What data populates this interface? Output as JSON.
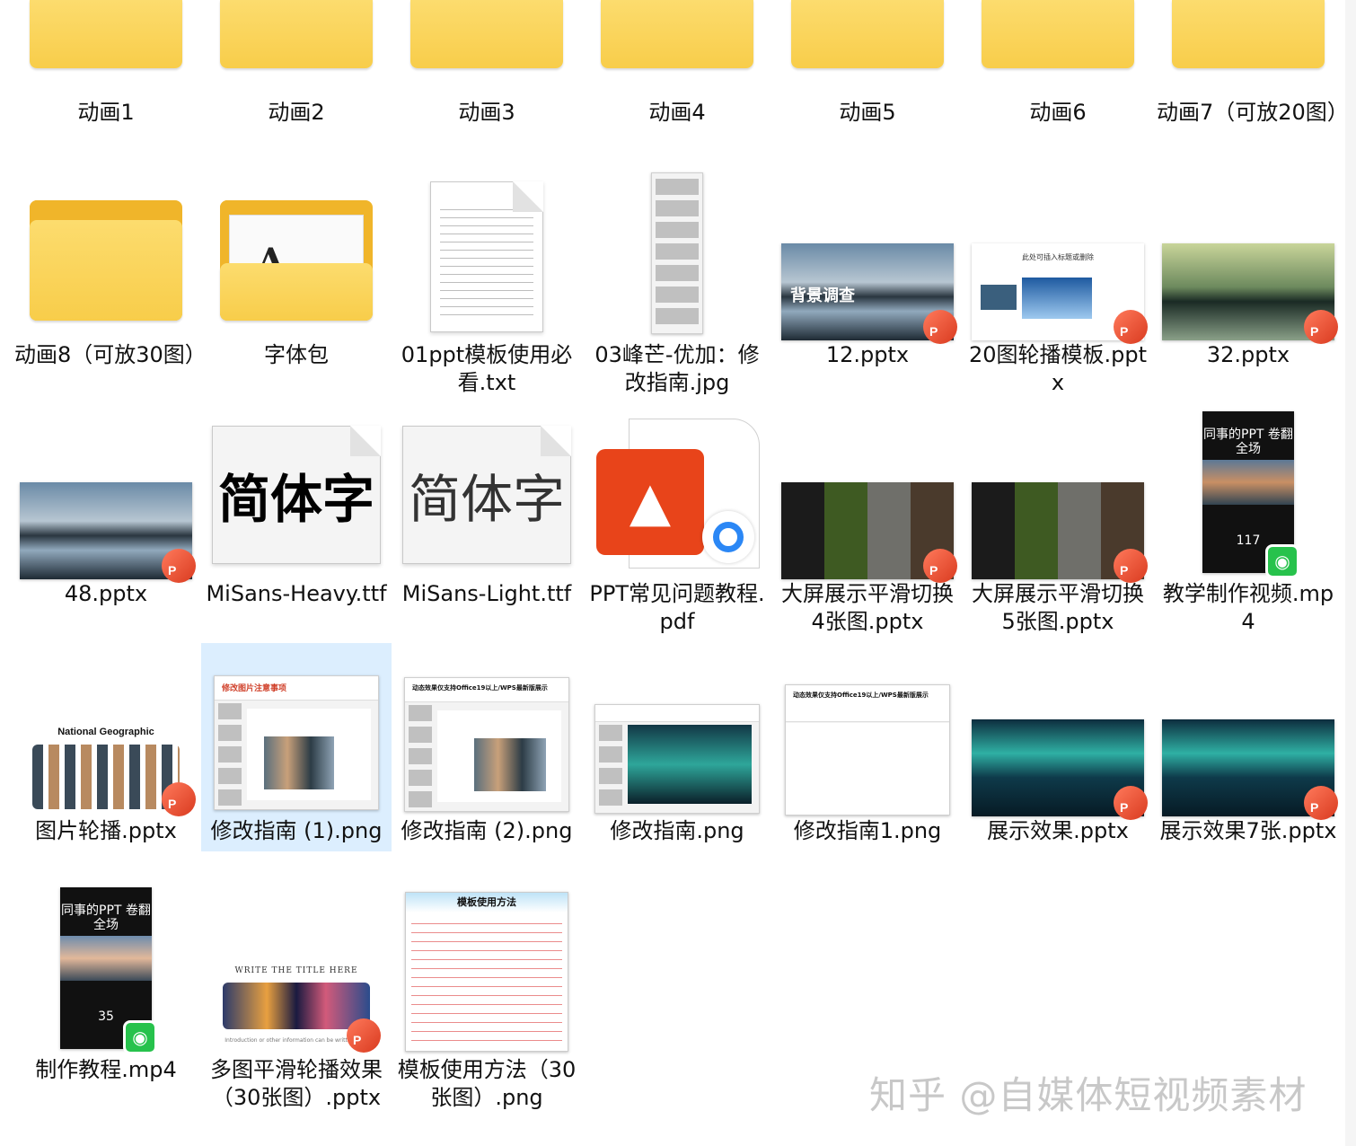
{
  "items": [
    {
      "label": "动画1",
      "kind": "folder-partial"
    },
    {
      "label": "动画2",
      "kind": "folder-partial"
    },
    {
      "label": "动画3",
      "kind": "folder-partial"
    },
    {
      "label": "动画4",
      "kind": "folder-partial"
    },
    {
      "label": "动画5",
      "kind": "folder-partial"
    },
    {
      "label": "动画6",
      "kind": "folder-partial"
    },
    {
      "label": "动画7（可放20图）",
      "kind": "folder-partial"
    },
    {
      "label": "动画8（可放30图）",
      "kind": "folder"
    },
    {
      "label": "字体包",
      "kind": "folder-with-file"
    },
    {
      "label": "01ppt模板使用必看.txt",
      "kind": "txt"
    },
    {
      "label": "03峰芒-优加：修改指南.jpg",
      "kind": "jpg-long"
    },
    {
      "label": "12.pptx",
      "kind": "pptx",
      "thumb_text": "背景调查"
    },
    {
      "label": "20图轮播模板.pptx",
      "kind": "pptx",
      "thumb_text": "此处可插入标题或删除"
    },
    {
      "label": "32.pptx",
      "kind": "pptx"
    },
    {
      "label": "48.pptx",
      "kind": "pptx"
    },
    {
      "label": "MiSans-Heavy.ttf",
      "kind": "font",
      "preview": "简体字"
    },
    {
      "label": "MiSans-Light.ttf",
      "kind": "font",
      "preview": "简体字"
    },
    {
      "label": "PPT常见问题教程.pdf",
      "kind": "pdf"
    },
    {
      "label": "大屏展示平滑切换4张图.pptx",
      "kind": "pptx"
    },
    {
      "label": "大屏展示平滑切换5张图.pptx",
      "kind": "pptx"
    },
    {
      "label": "教学制作视频.mp4",
      "kind": "mp4",
      "thumb_title": "同事的PPT 卷翻全场",
      "thumb_num": "117"
    },
    {
      "label": "图片轮播.pptx",
      "kind": "pptx",
      "thumb_text": "National Geographic"
    },
    {
      "label": "修改指南 (1).png",
      "kind": "png",
      "selected": true,
      "thumb_text": "修改图片注意事项"
    },
    {
      "label": "修改指南 (2).png",
      "kind": "png",
      "thumb_text": "动态效果仅支持Office19以上/WPS最新版展示"
    },
    {
      "label": "修改指南.png",
      "kind": "png"
    },
    {
      "label": "修改指南1.png",
      "kind": "png",
      "thumb_text": "动态效果仅支持Office19以上/WPS最新版展示"
    },
    {
      "label": "展示效果.pptx",
      "kind": "pptx"
    },
    {
      "label": "展示效果7张.pptx",
      "kind": "pptx"
    },
    {
      "label": "制作教程.mp4",
      "kind": "mp4",
      "thumb_title": "同事的PPT 卷翻全场",
      "thumb_num": "35"
    },
    {
      "label": "多图平滑轮播效果（30张图）.pptx",
      "kind": "pptx",
      "thumb_text": "WRITE THE TITLE HERE"
    },
    {
      "label": "模板使用方法（30张图）.png",
      "kind": "png",
      "thumb_text": "模板使用方法"
    }
  ],
  "watermark": "知乎 @自媒体短视频素材",
  "colors": {
    "selection": "#dceefe",
    "folder": "#f8cd4a",
    "ppt_badge": "#e0492a",
    "mp4_badge": "#27c24c"
  }
}
